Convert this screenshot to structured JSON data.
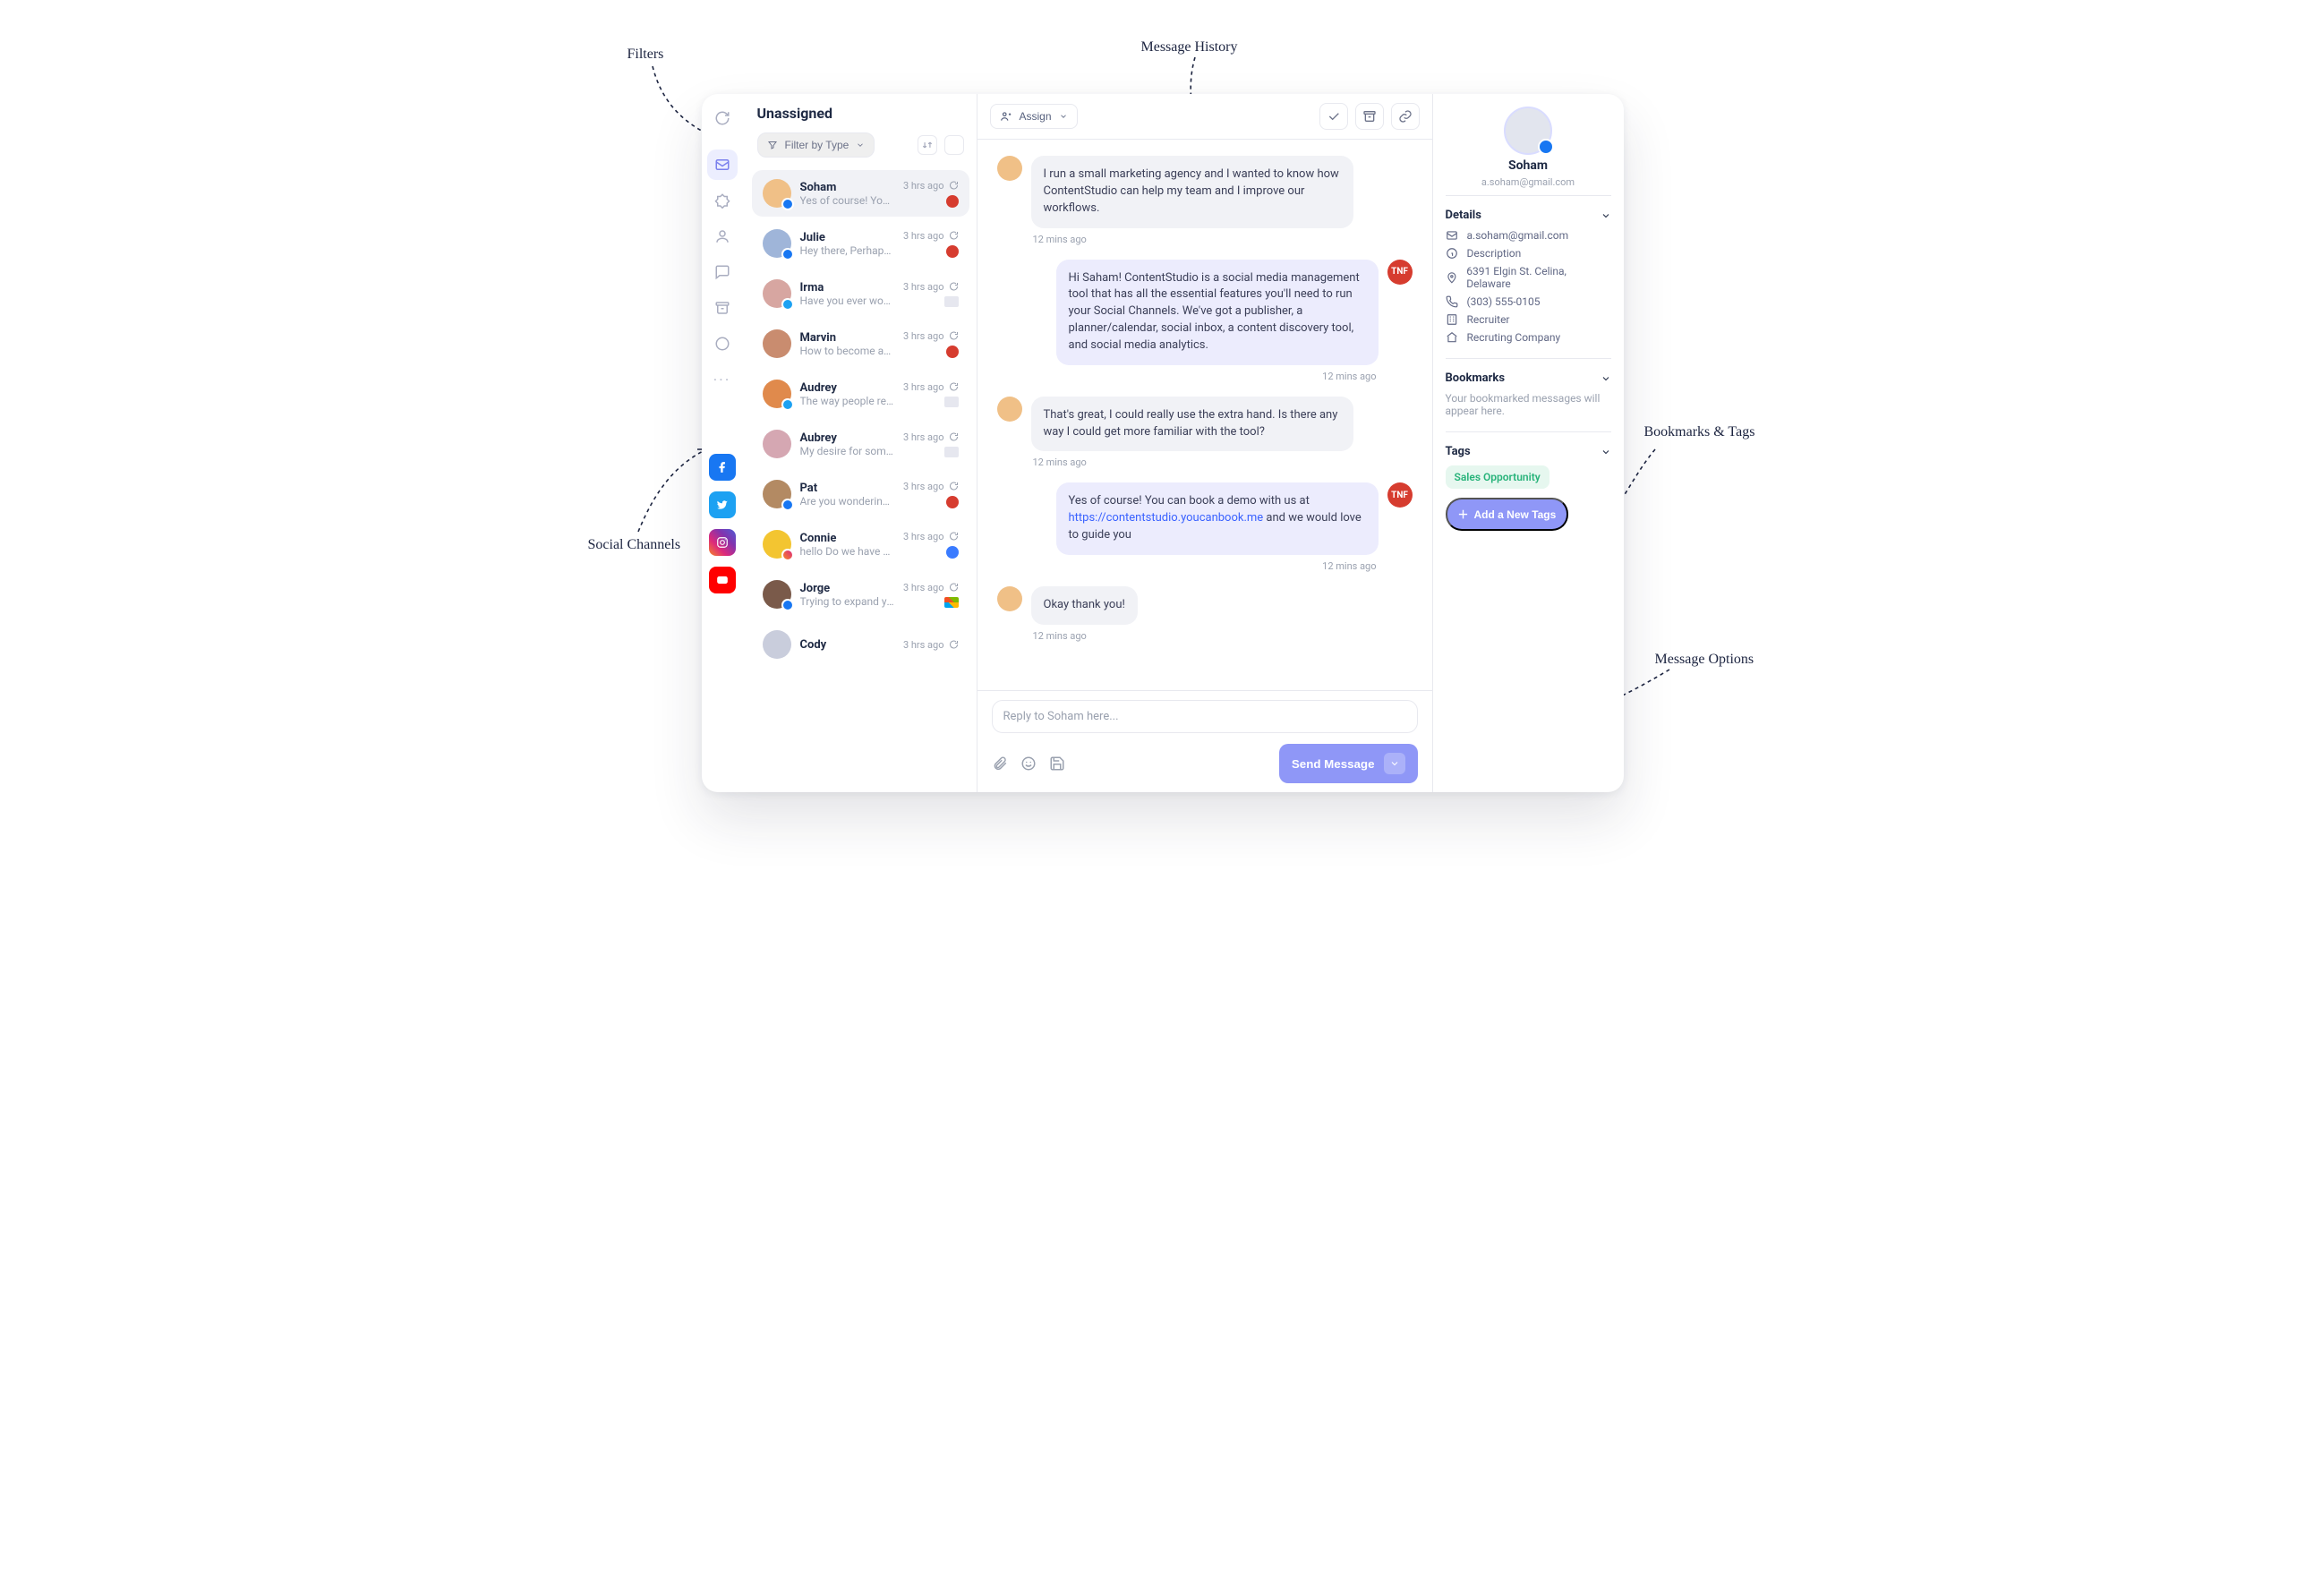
{
  "annotations": {
    "filters": "Filters",
    "history": "Message History",
    "social": "Social Channels",
    "bookmarks": "Bookmarks & Tags",
    "options": "Message Options"
  },
  "rail": {
    "items": [
      "refresh",
      "inbox",
      "badge",
      "user",
      "comment",
      "archive",
      "chat",
      "more"
    ]
  },
  "list": {
    "title": "Unassigned",
    "filter_label": "Filter by Type",
    "conversations": [
      {
        "name": "Soham",
        "time": "3 hrs ago",
        "preview": "Yes of course! You can book...",
        "platform": "fb",
        "brand": "red",
        "avatar": "#f0c087"
      },
      {
        "name": "Julie",
        "time": "3 hrs ago",
        "preview": "Hey there, Perhaps I could i...",
        "platform": "fb",
        "brand": "red",
        "avatar": "#9fb5d9"
      },
      {
        "name": "Irma",
        "time": "3 hrs ago",
        "preview": "Have you ever wondered",
        "platform": "tw",
        "brand": "chip",
        "avatar": "#d7a6a1"
      },
      {
        "name": "Marvin",
        "time": "3 hrs ago",
        "preview": "How to become an efficie",
        "platform": "",
        "brand": "red",
        "avatar": "#c98c6f"
      },
      {
        "name": "Audrey",
        "time": "3 hrs ago",
        "preview": "The way people reason th",
        "platform": "tw",
        "brand": "chip",
        "avatar": "#e08a4c"
      },
      {
        "name": "Aubrey",
        "time": "3 hrs ago",
        "preview": "My desire for something",
        "platform": "",
        "brand": "chip",
        "avatar": "#d5a7b2"
      },
      {
        "name": "Pat",
        "time": "3 hrs ago",
        "preview": "Are you wondering how",
        "platform": "fb",
        "brand": "red",
        "avatar": "#b38a63"
      },
      {
        "name": "Connie",
        "time": "3 hrs ago",
        "preview": "hello Do we have any update h...",
        "platform": "ig",
        "brand": "blue",
        "avatar": "#f3c531"
      },
      {
        "name": "Jorge",
        "time": "3 hrs ago",
        "preview": "Trying to expand your bus",
        "platform": "fb",
        "brand": "ms",
        "avatar": "#7a5a4a"
      },
      {
        "name": "Cody",
        "time": "3 hrs ago",
        "preview": "",
        "platform": "",
        "brand": "",
        "avatar": "#c9cddc"
      }
    ]
  },
  "thread": {
    "assign_label": "Assign",
    "messages": [
      {
        "side": "out",
        "text": "I run a small marketing agency and I wanted to know how ContentStudio can help my team and I improve our workflows.",
        "ts": "12 mins ago"
      },
      {
        "side": "in",
        "text": "Hi Saham! ContentStudio is a social media management tool that has all the essential features you'll need to run your Social Channels. We've got a publisher, a planner/calendar, social inbox, a content discovery tool, and social media analytics.",
        "ts": "12 mins ago"
      },
      {
        "side": "out",
        "text": "That's great, I could really use the extra hand. Is there any way I could get more familiar with the tool?",
        "ts": "12 mins ago"
      },
      {
        "side": "in",
        "html": true,
        "text": "Yes of course! You can book a demo with us at <a href='#'>https://contentstudio.youcanbook.me</a> and we would love to guide you",
        "ts": "12 mins ago"
      },
      {
        "side": "out",
        "text": "Okay thank you!",
        "ts": "12 mins ago"
      }
    ],
    "brand_initials": "TNF",
    "reply_placeholder": "Reply to Soham here...",
    "send_label": "Send Message"
  },
  "panel": {
    "name": "Soham",
    "email": "a.soham@gmail.com",
    "details_title": "Details",
    "details": {
      "email": "a.soham@gmail.com",
      "description": "Description",
      "address": "6391 Elgin St. Celina, Delaware",
      "phone": "(303) 555-0105",
      "role": "Recruiter",
      "company": "Recruting Company"
    },
    "bookmarks_title": "Bookmarks",
    "bookmarks_empty": "Your bookmarked messages will appear here.",
    "tags_title": "Tags",
    "tags": [
      "Sales Opportunity"
    ],
    "add_tag_label": "Add a New Tags"
  }
}
